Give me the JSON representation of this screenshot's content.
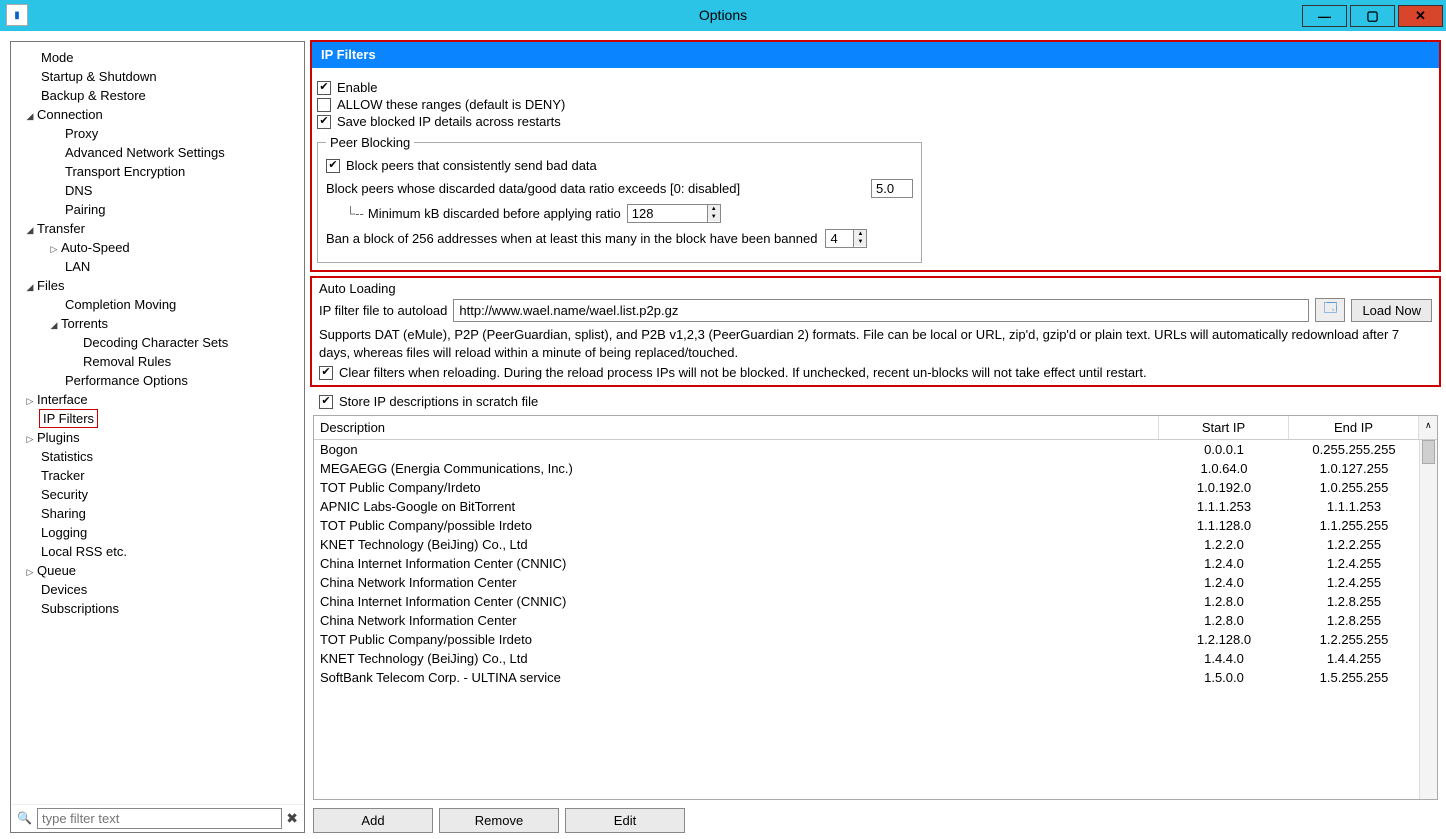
{
  "window": {
    "title": "Options"
  },
  "sidebar": {
    "filter_placeholder": "type filter text",
    "items": [
      {
        "label": "Mode",
        "depth": "depth-0"
      },
      {
        "label": "Startup & Shutdown",
        "depth": "depth-0"
      },
      {
        "label": "Backup & Restore",
        "depth": "depth-0"
      },
      {
        "label": "Connection",
        "depth": "depth-1",
        "toggle": "◢"
      },
      {
        "label": "Proxy",
        "depth": "depth-2"
      },
      {
        "label": "Advanced Network Settings",
        "depth": "depth-2"
      },
      {
        "label": "Transport Encryption",
        "depth": "depth-2"
      },
      {
        "label": "DNS",
        "depth": "depth-2"
      },
      {
        "label": "Pairing",
        "depth": "depth-2"
      },
      {
        "label": "Transfer",
        "depth": "depth-1",
        "toggle": "◢"
      },
      {
        "label": "Auto-Speed",
        "depth": "depth-2-expand",
        "toggle": "▷"
      },
      {
        "label": "LAN",
        "depth": "depth-2"
      },
      {
        "label": "Files",
        "depth": "depth-1",
        "toggle": "◢"
      },
      {
        "label": "Completion Moving",
        "depth": "depth-2"
      },
      {
        "label": "Torrents",
        "depth": "depth-2-expand",
        "toggle": "◢"
      },
      {
        "label": "Decoding Character Sets",
        "depth": "depth-3"
      },
      {
        "label": "Removal Rules",
        "depth": "depth-3"
      },
      {
        "label": "Performance Options",
        "depth": "depth-2"
      },
      {
        "label": "Interface",
        "depth": "depth-1",
        "toggle": "▷"
      },
      {
        "label": "IP Filters",
        "depth": "depth-0",
        "highlighted": true
      },
      {
        "label": "Plugins",
        "depth": "depth-1",
        "toggle": "▷"
      },
      {
        "label": "Statistics",
        "depth": "depth-0"
      },
      {
        "label": "Tracker",
        "depth": "depth-0"
      },
      {
        "label": "Security",
        "depth": "depth-0"
      },
      {
        "label": "Sharing",
        "depth": "depth-0"
      },
      {
        "label": "Logging",
        "depth": "depth-0"
      },
      {
        "label": "Local RSS etc.",
        "depth": "depth-0"
      },
      {
        "label": "Queue",
        "depth": "depth-1",
        "toggle": "▷"
      },
      {
        "label": "Devices",
        "depth": "depth-0"
      },
      {
        "label": "Subscriptions",
        "depth": "depth-0"
      }
    ]
  },
  "ipfilters": {
    "header": "IP Filters",
    "enable_label": "Enable",
    "allow_label": "ALLOW these ranges (default is DENY)",
    "save_blocked_label": "Save blocked IP details across restarts",
    "peer_blocking_legend": "Peer Blocking",
    "block_bad_label": "Block peers that consistently send bad data",
    "ratio_label": "Block peers whose discarded data/good data ratio exceeds [0: disabled]",
    "ratio_value": "5.0",
    "min_kb_label": "Minimum kB discarded before applying ratio",
    "min_kb_value": "128",
    "ban_block_label": "Ban a block of 256 addresses when at least this many in the block have been banned",
    "ban_block_value": "4"
  },
  "autoload": {
    "legend": "Auto Loading",
    "file_label": "IP filter file to autoload",
    "url_value": "http://www.wael.name/wael.list.p2p.gz",
    "load_now": "Load Now",
    "note": "Supports DAT (eMule), P2P (PeerGuardian, splist), and P2B v1,2,3 (PeerGuardian 2) formats.  File can be local or URL, zip'd, gzip'd or plain text.  URLs will automatically redownload after 7 days, whereas files will reload within a minute of being replaced/touched.",
    "clear_label": "Clear filters when reloading. During the reload process IPs will not be blocked. If unchecked, recent un-blocks will not take effect until restart."
  },
  "store_scratch_label": "Store IP descriptions in scratch file",
  "table": {
    "cols": {
      "desc": "Description",
      "start": "Start IP",
      "end": "End IP"
    },
    "rows": [
      {
        "desc": "Bogon",
        "start": "0.0.0.1",
        "end": "0.255.255.255"
      },
      {
        "desc": "MEGAEGG (Energia Communications, Inc.)",
        "start": "1.0.64.0",
        "end": "1.0.127.255"
      },
      {
        "desc": "TOT Public Company/Irdeto",
        "start": "1.0.192.0",
        "end": "1.0.255.255"
      },
      {
        "desc": "APNIC Labs-Google on BitTorrent",
        "start": "1.1.1.253",
        "end": "1.1.1.253"
      },
      {
        "desc": "TOT Public Company/possible Irdeto",
        "start": "1.1.128.0",
        "end": "1.1.255.255"
      },
      {
        "desc": "KNET Technology (BeiJing) Co., Ltd",
        "start": "1.2.2.0",
        "end": "1.2.2.255"
      },
      {
        "desc": "China Internet Information Center (CNNIC)",
        "start": "1.2.4.0",
        "end": "1.2.4.255"
      },
      {
        "desc": "China Network Information Center",
        "start": "1.2.4.0",
        "end": "1.2.4.255"
      },
      {
        "desc": "China Internet Information Center (CNNIC)",
        "start": "1.2.8.0",
        "end": "1.2.8.255"
      },
      {
        "desc": "China Network Information Center",
        "start": "1.2.8.0",
        "end": "1.2.8.255"
      },
      {
        "desc": "TOT Public Company/possible Irdeto",
        "start": "1.2.128.0",
        "end": "1.2.255.255"
      },
      {
        "desc": "KNET Technology (BeiJing) Co., Ltd",
        "start": "1.4.4.0",
        "end": "1.4.4.255"
      },
      {
        "desc": "SoftBank Telecom Corp. - ULTINA service",
        "start": "1.5.0.0",
        "end": "1.5.255.255"
      }
    ]
  },
  "buttons": {
    "add": "Add",
    "remove": "Remove",
    "edit": "Edit"
  }
}
